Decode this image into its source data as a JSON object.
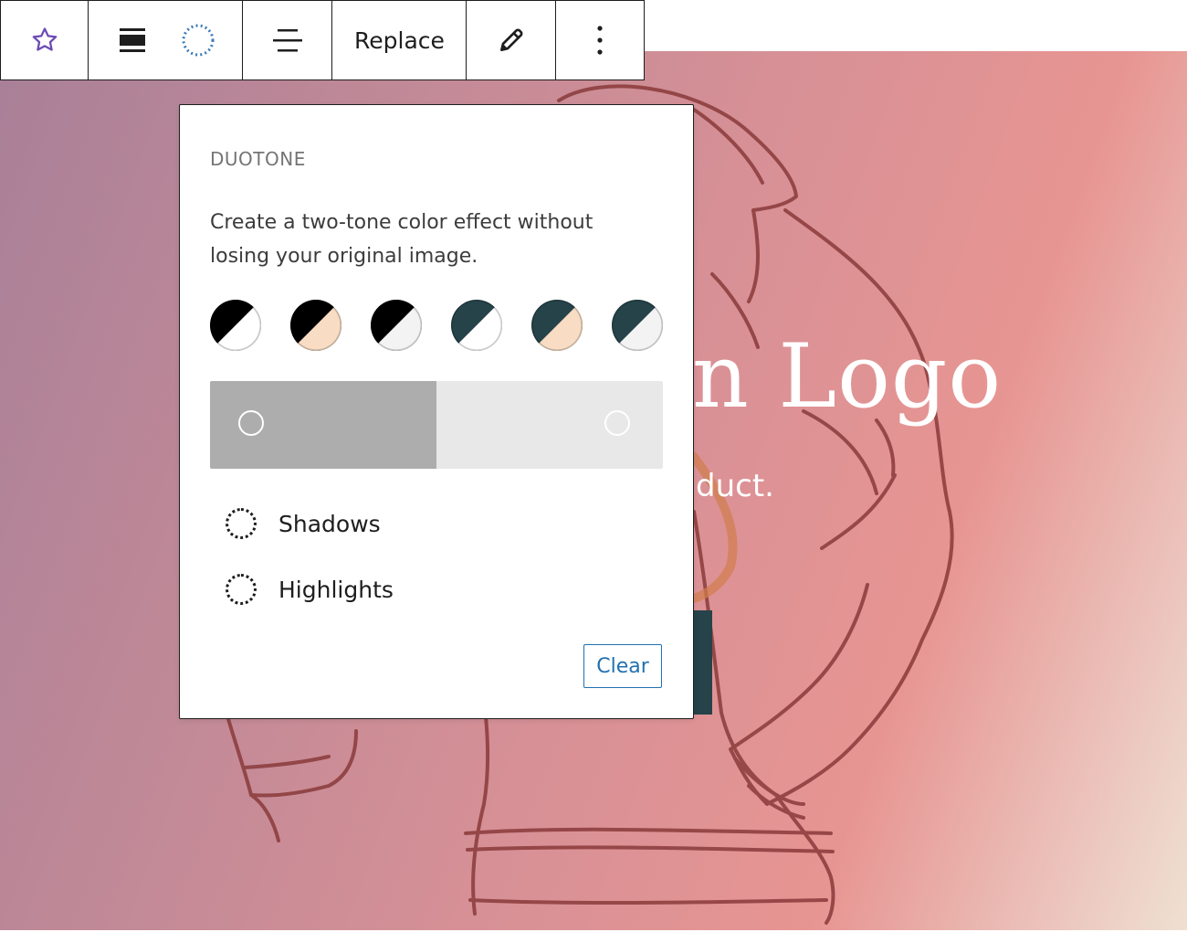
{
  "colors": {
    "accent": "#2271b1",
    "star": "#6c4ab4",
    "duotone_ring": "#3a7ab8",
    "text_dark": "#1e1e1e",
    "text_muted": "#757575"
  },
  "toolbar": {
    "replace_label": "Replace",
    "icons": [
      "star-icon",
      "full-width-align-icon",
      "duotone-icon",
      "text-align-icon",
      "pencil-icon",
      "more-vertical-icon"
    ]
  },
  "hero": {
    "title_visible": "n Logo",
    "subtitle_visible": "duct."
  },
  "duotone_panel": {
    "title": "DUOTONE",
    "description": "Create a two-tone color effect without losing your original image.",
    "presets": [
      {
        "a": "#000000",
        "b": "#ffffff"
      },
      {
        "a": "#000000",
        "b": "#f8dcc3"
      },
      {
        "a": "#000000",
        "b": "#f3f3f3"
      },
      {
        "a": "#26434a",
        "b": "#ffffff"
      },
      {
        "a": "#26434a",
        "b": "#f8dcc3"
      },
      {
        "a": "#26434a",
        "b": "#f3f3f3"
      }
    ],
    "gradient": {
      "left_color": "#adadad",
      "right_color": "#e8e8e8"
    },
    "shadows_label": "Shadows",
    "highlights_label": "Highlights",
    "clear_label": "Clear"
  }
}
